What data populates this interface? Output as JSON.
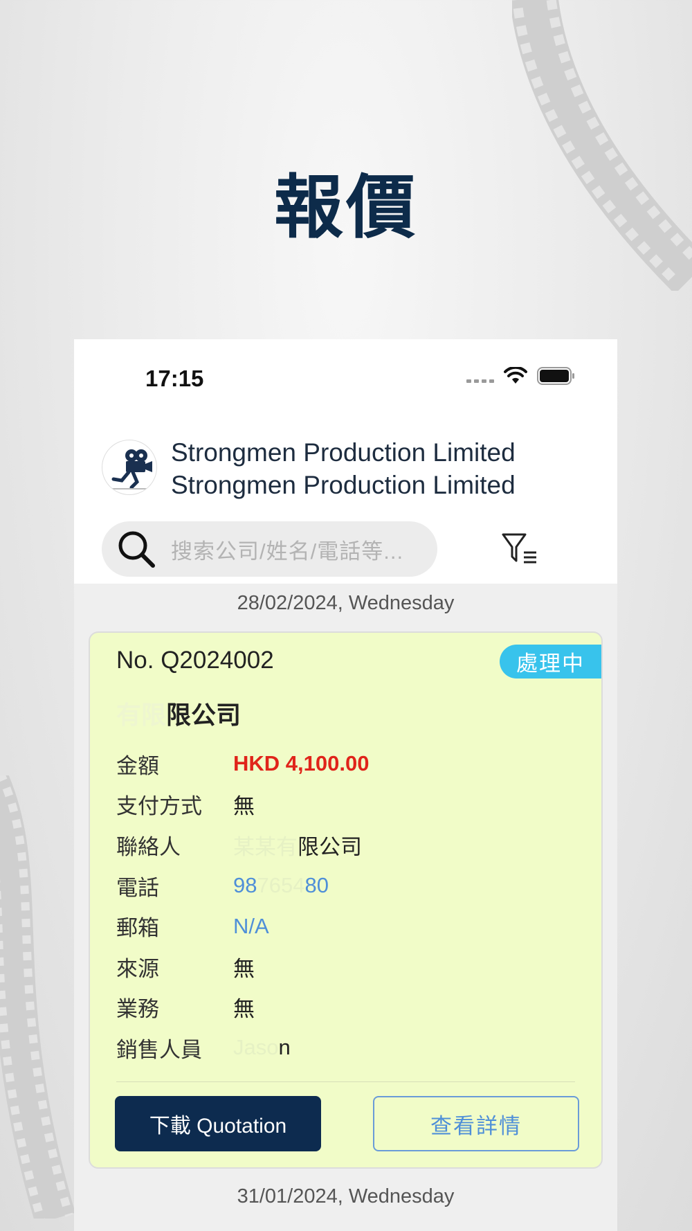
{
  "promo_title": "報價",
  "status_bar": {
    "time": "17:15",
    "icons": [
      "signal-icon",
      "wifi-icon",
      "battery-icon"
    ]
  },
  "header": {
    "company_line1": "Strongmen Production Limited",
    "company_line2": "Strongmen Production Limited",
    "search_placeholder": "搜索公司/姓名/電話等..."
  },
  "groups": [
    {
      "date": "28/02/2024, Wednesday",
      "quotation": {
        "number": "No. Q2024002",
        "status": "處理中",
        "company_visible": "限公司",
        "fields": [
          {
            "label": "金額",
            "value": "HKD 4,100.00"
          },
          {
            "label": "支付方式",
            "value": "無"
          },
          {
            "label": "聯絡人",
            "value": "限公司"
          },
          {
            "label": "電話",
            "value_start": "98",
            "value_end": "80"
          },
          {
            "label": "郵箱",
            "value": "N/A"
          },
          {
            "label": "來源",
            "value": "無"
          },
          {
            "label": "業務",
            "value": "無"
          },
          {
            "label": "銷售人員",
            "value": "n"
          }
        ],
        "download_button": "下載 Quotation",
        "view_button": "查看詳情"
      }
    },
    {
      "date": "31/01/2024, Wednesday"
    }
  ],
  "colors": {
    "brand_navy": "#0d2b4f",
    "card_bg": "#f1fcc8",
    "status_badge": "#38c3ec",
    "amount_red": "#e0241a",
    "link_blue": "#4f8fd8"
  }
}
